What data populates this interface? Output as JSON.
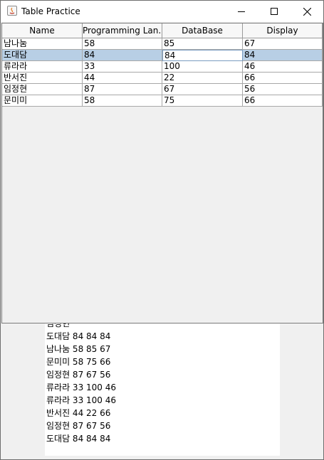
{
  "window": {
    "title": "Table Practice"
  },
  "table": {
    "columns": [
      "Name",
      "Programming Lan...",
      "DataBase",
      "Display"
    ],
    "rows": [
      [
        "남나눔",
        "58",
        "85",
        "67"
      ],
      [
        "도대담",
        "84",
        "84",
        "84"
      ],
      [
        "류라라",
        "33",
        "100",
        "46"
      ],
      [
        "반서진",
        "44",
        "22",
        "66"
      ],
      [
        "임정현",
        "87",
        "67",
        "56"
      ],
      [
        "문미미",
        "58",
        "75",
        "66"
      ]
    ],
    "selected_row": 1,
    "focused_column": 2
  },
  "log": {
    "lines": [
      "임정현",
      "도대담 84 84 84",
      "남나눔 58 85 67",
      "문미미 58 75 66",
      "임정현 87 67 56",
      "류라라 33 100 46",
      "류라라 33 100 46",
      "반서진 44 22 66",
      "임정현 87 67 56",
      "도대담 84 84 84"
    ]
  },
  "colors": {
    "selection": "#b8cfe5",
    "grid": "#a8a8a8"
  }
}
